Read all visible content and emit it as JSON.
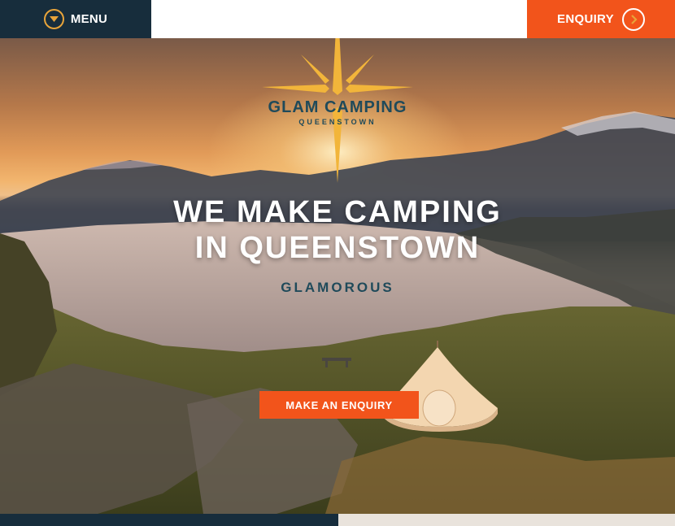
{
  "header": {
    "menu_label": "MENU",
    "enquiry_label": "ENQUIRY"
  },
  "logo": {
    "title": "GLAM CAMPING",
    "subtitle": "QUEENSTOWN"
  },
  "hero": {
    "headline_line1": "WE MAKE CAMPING",
    "headline_line2": "IN QUEENSTOWN",
    "tagline": "GLAMOROUS",
    "cta_label": "MAKE AN ENQUIRY"
  },
  "colors": {
    "navy": "#172d3c",
    "orange": "#f2541b",
    "gold": "#e8a43a",
    "teal": "#1f4a5a"
  }
}
